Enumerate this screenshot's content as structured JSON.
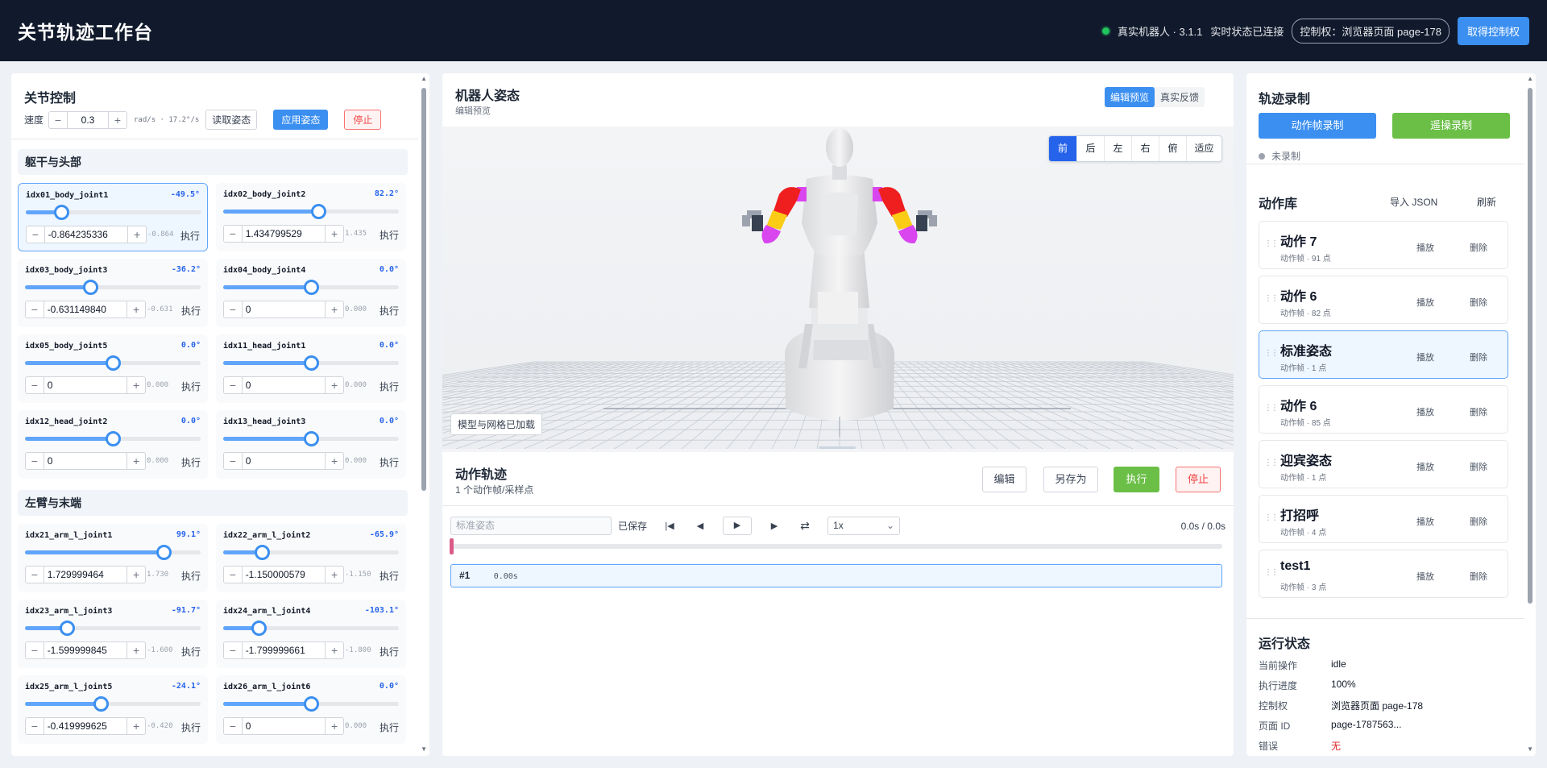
{
  "header": {
    "title": "关节轨迹工作台",
    "robot_status": "真实机器人 · 3.1.1",
    "realtime": "实时状态已连接",
    "control": "控制权：浏览器页面 page-178",
    "take_control": "取得控制权",
    "status_color": "#22c55e"
  },
  "left": {
    "title": "关节控制",
    "speed_label": "速度",
    "speed_value": "0.3",
    "speed_unit": "rad/s · 17.2°/s",
    "read_pose": "读取姿态",
    "apply_pose": "应用姿态",
    "stop": "停止",
    "sections": [
      {
        "title": "躯干与头部",
        "joints": [
          {
            "name": "idx01_body_joint1",
            "value": "-49.5°",
            "input": "-0.864235336",
            "mini": "-0.864",
            "exec": "执行",
            "level": 0.2
          },
          {
            "name": "idx02_body_joint2",
            "value": "82.2°",
            "input": "1.434799529",
            "mini": "1.435",
            "exec": "执行",
            "level": 0.54
          },
          {
            "name": "idx03_body_joint3",
            "value": "-36.2°",
            "input": "-0.631149840",
            "mini": "-0.631",
            "exec": "执行",
            "level": 0.37
          },
          {
            "name": "idx04_body_joint4",
            "value": "0.0°",
            "input": "0",
            "mini": "0.000",
            "exec": "执行",
            "level": 0.5
          },
          {
            "name": "idx05_body_joint5",
            "value": "0.0°",
            "input": "0",
            "mini": "0.000",
            "exec": "执行",
            "level": 0.5
          },
          {
            "name": "idx11_head_joint1",
            "value": "0.0°",
            "input": "0",
            "mini": "0.000",
            "exec": "执行",
            "level": 0.5
          },
          {
            "name": "idx12_head_joint2",
            "value": "0.0°",
            "input": "0",
            "mini": "0.000",
            "exec": "执行",
            "level": 0.5
          },
          {
            "name": "idx13_head_joint3",
            "value": "0.0°",
            "input": "0",
            "mini": "0.000",
            "exec": "执行",
            "level": 0.5
          }
        ]
      },
      {
        "title": "左臂与末端",
        "joints": [
          {
            "name": "idx21_arm_l_joint1",
            "value": "99.1°",
            "input": "1.729999464",
            "mini": "1.730",
            "exec": "执行",
            "level": 0.79
          },
          {
            "name": "idx22_arm_l_joint2",
            "value": "-65.9°",
            "input": "-1.150000579",
            "mini": "-1.150",
            "exec": "执行",
            "level": 0.22
          },
          {
            "name": "idx23_arm_l_joint3",
            "value": "-91.7°",
            "input": "-1.599999845",
            "mini": "-1.600",
            "exec": "执行",
            "level": 0.24
          },
          {
            "name": "idx24_arm_l_joint4",
            "value": "-103.1°",
            "input": "-1.799999661",
            "mini": "-1.800",
            "exec": "执行",
            "level": 0.2
          },
          {
            "name": "idx25_arm_l_joint5",
            "value": "-24.1°",
            "input": "-0.419999625",
            "mini": "-0.420",
            "exec": "执行",
            "level": 0.43
          },
          {
            "name": "idx26_arm_l_joint6",
            "value": "0.0°",
            "input": "0",
            "mini": "0.000",
            "exec": "执行",
            "level": 0.5
          }
        ]
      }
    ]
  },
  "center": {
    "title": "机器人姿态",
    "subtitle": "编辑预览",
    "mode_tabs": [
      "编辑预览",
      "真实反馈"
    ],
    "views": [
      "前",
      "后",
      "左",
      "右",
      "俯",
      "适应"
    ],
    "loaded": "模型与网格已加载",
    "traj": {
      "title": "动作轨迹",
      "subtitle": "1 个动作帧/采样点",
      "edit": "编辑",
      "saveas": "另存为",
      "execute": "执行",
      "stop": "停止",
      "name_placeholder": "标准姿态",
      "saved": "已保存",
      "speed": "1x",
      "time": "0.0s / 0.0s",
      "frames": [
        {
          "index": "#1",
          "time": "0.00s"
        }
      ]
    }
  },
  "right": {
    "rec_title": "轨迹录制",
    "frame_rec": "动作帧录制",
    "teleop_rec": "遥操录制",
    "rec_status": "未录制",
    "lib_title": "动作库",
    "import": "导入 JSON",
    "refresh": "刷新",
    "actions": [
      {
        "name": "动作 7",
        "desc": "动作帧 · 91 点",
        "play": "播放",
        "del": "删除"
      },
      {
        "name": "动作 6",
        "desc": "动作帧 · 82 点",
        "play": "播放",
        "del": "删除"
      },
      {
        "name": "标准姿态",
        "desc": "动作帧 · 1 点",
        "play": "播放",
        "del": "删除"
      },
      {
        "name": "动作 6",
        "desc": "动作帧 · 85 点",
        "play": "播放",
        "del": "删除"
      },
      {
        "name": "迎宾姿态",
        "desc": "动作帧 · 1 点",
        "play": "播放",
        "del": "删除"
      },
      {
        "name": "打招呼",
        "desc": "动作帧 · 4 点",
        "play": "播放",
        "del": "删除"
      },
      {
        "name": "test1",
        "desc": "动作帧 · 3 点",
        "play": "播放",
        "del": "删除"
      }
    ],
    "status_title": "运行状态",
    "status": [
      {
        "k": "当前操作",
        "v": "idle"
      },
      {
        "k": "执行进度",
        "v": "100%"
      },
      {
        "k": "控制权",
        "v": "浏览器页面 page-178"
      },
      {
        "k": "页面 ID",
        "v": "page-1787563..."
      },
      {
        "k": "错误",
        "v": "无"
      }
    ]
  }
}
